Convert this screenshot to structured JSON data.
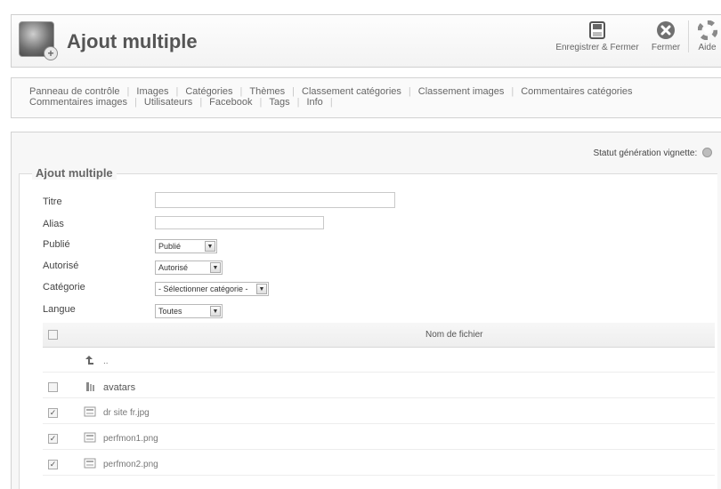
{
  "header": {
    "title": "Ajout multiple",
    "toolbar": {
      "save_label": "Enregistrer & Fermer",
      "close_label": "Fermer",
      "help_label": "Aide"
    }
  },
  "submenu": {
    "row1": [
      "Panneau de contrôle",
      "Images",
      "Catégories",
      "Thèmes",
      "Classement catégories",
      "Classement images",
      "Commentaires catégories"
    ],
    "row2": [
      "Commentaires images",
      "Utilisateurs",
      "Facebook",
      "Tags",
      "Info"
    ]
  },
  "status": {
    "label": "Statut génération vignette:"
  },
  "form": {
    "legend": "Ajout multiple",
    "fields": {
      "titre": {
        "label": "Titre",
        "value": ""
      },
      "alias": {
        "label": "Alias",
        "value": ""
      },
      "publie": {
        "label": "Publié",
        "value": "Publié"
      },
      "autorise": {
        "label": "Autorisé",
        "value": "Autorisé"
      },
      "categorie": {
        "label": "Catégorie",
        "value": "- Sélectionner catégorie -"
      },
      "langue": {
        "label": "Langue",
        "value": "Toutes"
      }
    }
  },
  "files": {
    "column_header": "Nom de fichier",
    "rows": [
      {
        "name": "..",
        "type": "parent-folder-icon",
        "checked": null
      },
      {
        "name": "avatars",
        "type": "folder-icon",
        "checked": false
      },
      {
        "name": "dr site fr.jpg",
        "type": "image-file-icon",
        "checked": true
      },
      {
        "name": "perfmon1.png",
        "type": "image-file-icon",
        "checked": true
      },
      {
        "name": "perfmon2.png",
        "type": "image-file-icon",
        "checked": true
      }
    ]
  },
  "colors": {
    "accent": "#555555",
    "panel_bg": "#f7f7f7",
    "border": "#d2d2d2"
  }
}
